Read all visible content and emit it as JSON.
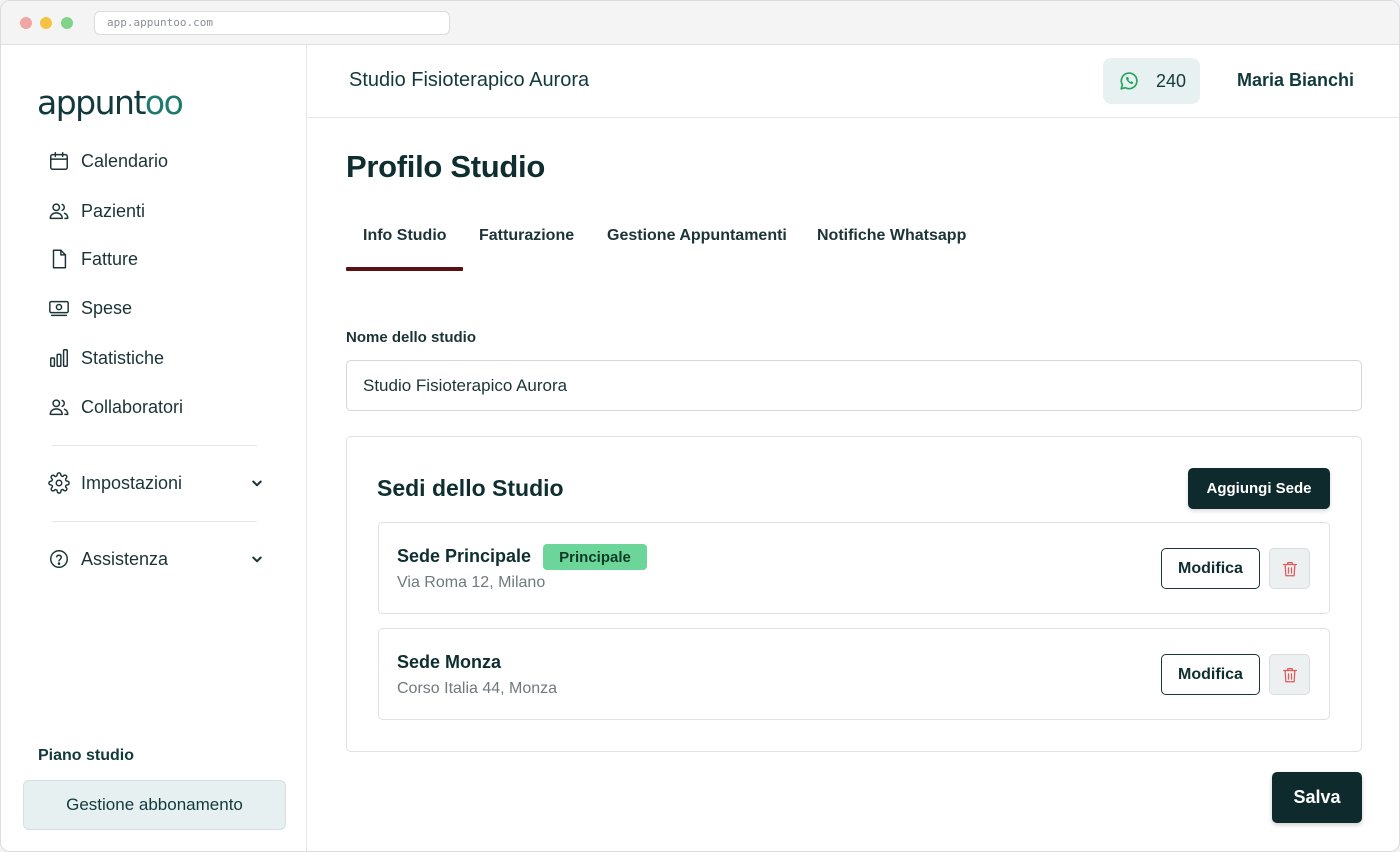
{
  "browser": {
    "url": "app.appuntoo.com"
  },
  "brand": {
    "logo_text_a": "appunt",
    "logo_text_b": "oo"
  },
  "sidebar": {
    "items": [
      {
        "label": "Calendario",
        "icon": "calendar-icon"
      },
      {
        "label": "Pazienti",
        "icon": "users-icon"
      },
      {
        "label": "Fatture",
        "icon": "file-icon"
      },
      {
        "label": "Spese",
        "icon": "banknote-icon"
      },
      {
        "label": "Statistiche",
        "icon": "bar-chart-icon"
      },
      {
        "label": "Collaboratori",
        "icon": "users-icon"
      }
    ],
    "settings": {
      "label": "Impostazioni",
      "icon": "gear-icon"
    },
    "help": {
      "label": "Assistenza",
      "icon": "help-circle-icon"
    },
    "plan_label": "Piano studio",
    "plan_button": "Gestione abbonamento"
  },
  "header": {
    "studio_name": "Studio Fisioterapico Aurora",
    "whatsapp_credits": "240",
    "user_name": "Maria Bianchi"
  },
  "page": {
    "title": "Profilo Studio",
    "tabs": [
      {
        "label": "Info Studio",
        "active": true
      },
      {
        "label": "Fatturazione",
        "active": false
      },
      {
        "label": "Gestione Appuntamenti",
        "active": false
      },
      {
        "label": "Notifiche Whatsapp",
        "active": false
      }
    ],
    "name_field": {
      "label": "Nome dello studio",
      "value": "Studio Fisioterapico Aurora"
    },
    "locations": {
      "title": "Sedi dello Studio",
      "add_button": "Aggiungi Sede",
      "items": [
        {
          "name": "Sede Principale",
          "badge": "Principale",
          "address": "Via Roma 12, Milano",
          "edit_label": "Modifica"
        },
        {
          "name": "Sede Monza",
          "badge": "",
          "address": "Corso Italia 44, Monza",
          "edit_label": "Modifica"
        }
      ]
    },
    "save_button": "Salva"
  },
  "colors": {
    "primary": "#0e2a2c",
    "tab_active": "#5a0f12",
    "badge_green": "#6cd69a",
    "whatsapp_green": "#25a55f",
    "delete_red": "#e05a5a"
  }
}
